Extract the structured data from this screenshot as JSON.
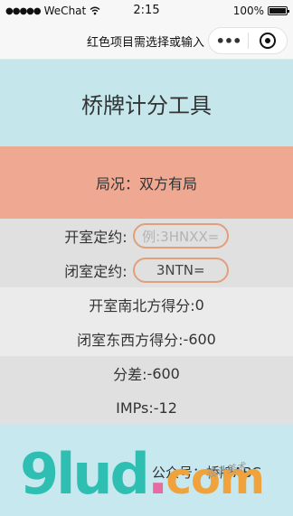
{
  "status": {
    "carrier": "WeChat",
    "time": "2:15",
    "battery": "100%"
  },
  "navbar": {
    "title": "红色项目需选择或输入"
  },
  "app": {
    "title": "桥牌计分工具"
  },
  "situation": {
    "label": "局况：",
    "value": "双方有局"
  },
  "contracts": {
    "open_label": "开室定约:",
    "open_placeholder": "例:3HNXX=",
    "closed_label": "闭室定约:",
    "closed_value": "3NTN="
  },
  "scores": {
    "open_ns_label": "开室南北方得分:",
    "open_ns_value": "0",
    "closed_ew_label": "闭室东西方得分:",
    "closed_ew_value": "-600",
    "diff_label": "分差:",
    "diff_value": "-600",
    "imps_label": "IMPs:",
    "imps_value": "-12"
  },
  "footer": {
    "account_label": "公众号：",
    "account_value": "桥牌ABC"
  },
  "watermark": {
    "brand": "9lud.com",
    "handwritten": "设计美术"
  }
}
